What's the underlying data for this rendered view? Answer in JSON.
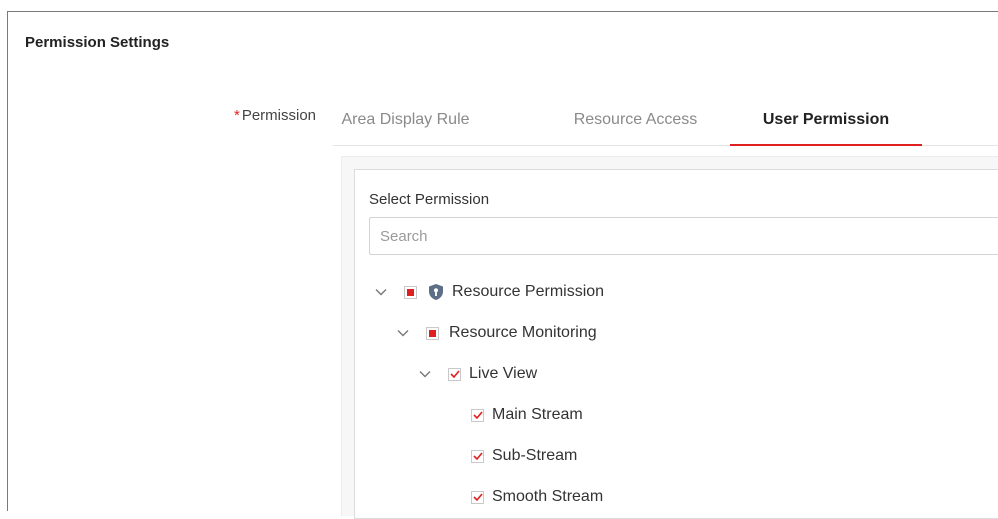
{
  "section": {
    "title": "Permission Settings"
  },
  "permission_field": {
    "required_mark": "*",
    "label": "Permission"
  },
  "tabs": [
    {
      "label": "Area Display Rule",
      "active": false
    },
    {
      "label": "Resource Access",
      "active": false
    },
    {
      "label": "User Permission",
      "active": true
    }
  ],
  "panel": {
    "select_label": "Select Permission",
    "search_placeholder": "Search",
    "search_value": ""
  },
  "tree": [
    {
      "label": "Resource Permission",
      "state": "partial",
      "expanded": true,
      "icon": "shield-icon"
    },
    {
      "label": "Resource Monitoring",
      "state": "partial",
      "expanded": true
    },
    {
      "label": "Live View",
      "state": "checked",
      "expanded": true
    },
    {
      "label": "Main Stream",
      "state": "checked"
    },
    {
      "label": "Sub-Stream",
      "state": "checked"
    },
    {
      "label": "Smooth Stream",
      "state": "checked"
    }
  ],
  "colors": {
    "accent": "#e02020",
    "text": "#333333",
    "muted_tab": "#8a8a8a",
    "shield": "#5c6f86"
  }
}
